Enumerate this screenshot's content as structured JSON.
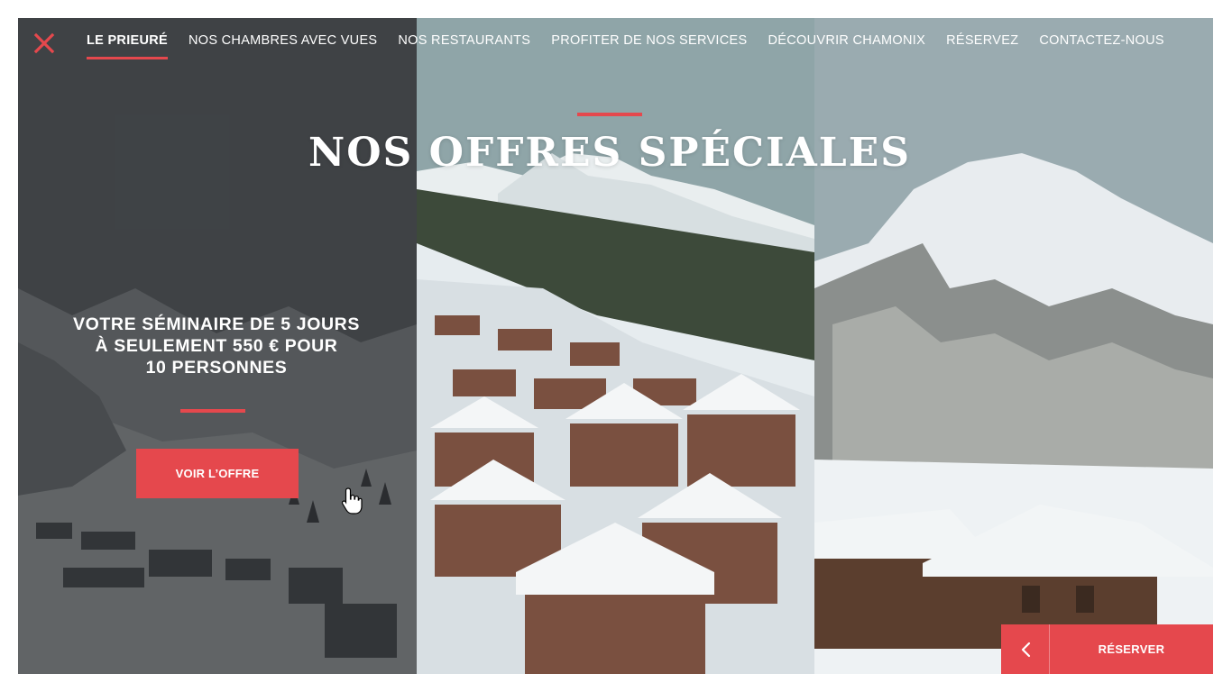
{
  "nav": {
    "items": [
      {
        "label": "LE PRIEURÉ",
        "active": true
      },
      {
        "label": "NOS CHAMBRES AVEC VUES",
        "active": false
      },
      {
        "label": "NOS RESTAURANTS",
        "active": false
      },
      {
        "label": "PROFITER DE NOS SERVICES",
        "active": false
      },
      {
        "label": "DÉCOUVRIR CHAMONIX",
        "active": false
      },
      {
        "label": "RÉSERVEZ",
        "active": false
      },
      {
        "label": "CONTACTEZ-NOUS",
        "active": false
      }
    ],
    "close_icon": "close-icon"
  },
  "hero": {
    "title": "NOS OFFRES SPÉCIALES"
  },
  "offer": {
    "lines": [
      "VOTRE SÉMINAIRE DE 5 JOURS",
      "À SEULEMENT 550 € POUR",
      "10 PERSONNES"
    ],
    "button_label": "VOIR L’OFFRE"
  },
  "reserve": {
    "label": "RÉSERVER",
    "back_icon": "chevron-left-icon"
  },
  "colors": {
    "accent": "#e5484d",
    "text_light": "#ffffff"
  }
}
